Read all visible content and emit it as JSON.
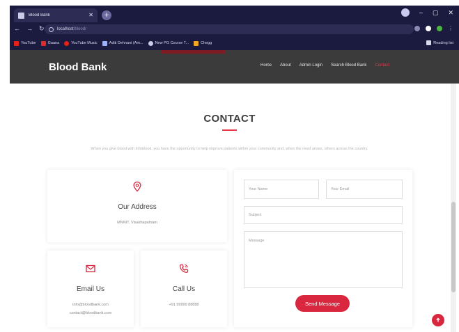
{
  "browser": {
    "tab_title": "Blood Bank",
    "url_host": "localhost",
    "url_path": "/blood/",
    "bookmarks": [
      {
        "label": "YouTube",
        "icon": "youtube-icon",
        "color": "#e62117"
      },
      {
        "label": "Gaana",
        "icon": "gaana-icon",
        "color": "#e02a2a"
      },
      {
        "label": "YouTube Music",
        "icon": "youtube-music-icon",
        "color": "#e62117"
      },
      {
        "label": "Aditi Dehnani (Am...",
        "icon": "x-icon",
        "color": "#9bb2ff"
      },
      {
        "label": "New PG Course T...",
        "icon": "globe-icon",
        "color": "#c9cbe8"
      },
      {
        "label": "Chegg",
        "icon": "chegg-icon",
        "color": "#f5a623"
      }
    ],
    "reading_list": "Reading list"
  },
  "site": {
    "logo": "Blood Bank",
    "nav": [
      "Home",
      "About",
      "Admin Login",
      "Search Blood Bank",
      "Contact"
    ],
    "active_nav": "Contact"
  },
  "contact": {
    "title": "CONTACT",
    "intro": "When you give blood with Infoblood, you have the opportunity to help improve patients within your community and, when the need arises, others across the country.",
    "address": {
      "title": "Our Address",
      "text": "MNNIT, Visakhapatnam"
    },
    "email": {
      "title": "Email Us",
      "lines": [
        "info@bloodbank.com",
        "contact@bloodbank.com"
      ]
    },
    "call": {
      "title": "Call Us",
      "text": "+91 99999 88888"
    },
    "form": {
      "name_placeholder": "Your Name",
      "email_placeholder": "Your Email",
      "subject_placeholder": "Subject",
      "message_placeholder": "Message",
      "send_label": "Send Message"
    }
  },
  "colors": {
    "accent": "#d8273e",
    "header_bg": "#3b3b3b",
    "chrome_bg": "#1b1a3f"
  }
}
